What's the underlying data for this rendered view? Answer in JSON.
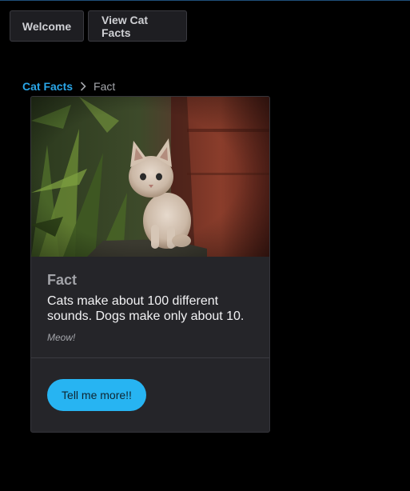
{
  "nav": {
    "welcome_label": "Welcome",
    "view_facts_label": "View Cat Facts"
  },
  "breadcrumb": {
    "link_label": "Cat Facts",
    "separator_icon": "chevron-right-icon",
    "current_label": "Fact"
  },
  "card": {
    "image_subject": "kitten photo",
    "title": "Fact",
    "text": "Cats make about 100 different sounds. Dogs make only about 10.",
    "subtext": "Meow!",
    "action_label": "Tell me more!!"
  },
  "colors": {
    "background": "#000000",
    "card": "#252529",
    "accent": "#27b4f2",
    "link": "#2aa6e8"
  }
}
